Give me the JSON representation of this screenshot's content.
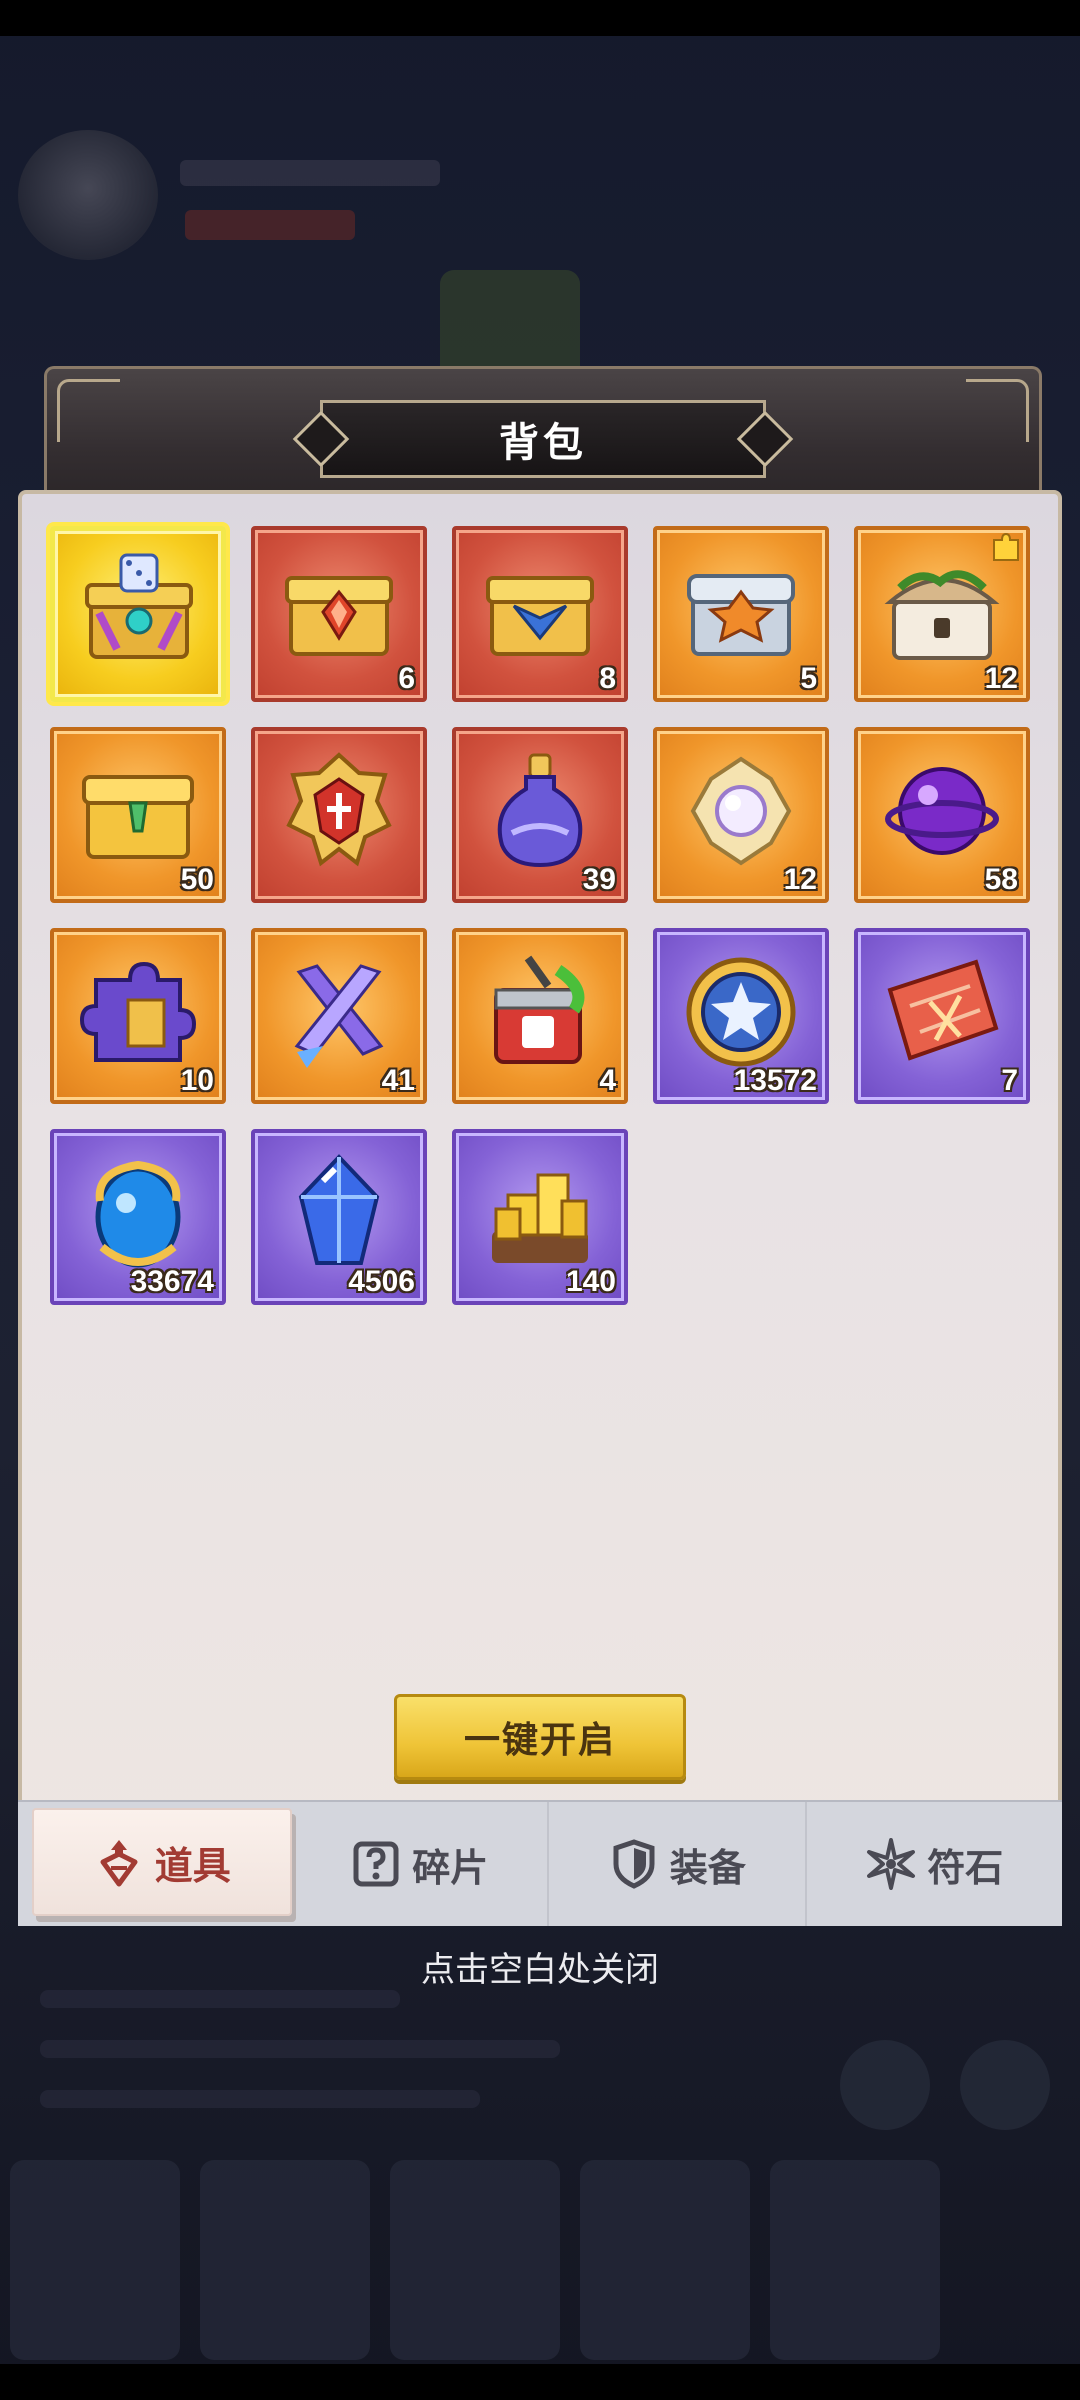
{
  "title": "背包",
  "open_all_label": "一键开启",
  "close_hint": "点击空白处关闭",
  "tabs": [
    {
      "label": "道具",
      "icon": "items-icon",
      "active": true
    },
    {
      "label": "碎片",
      "icon": "fragment-icon",
      "active": false
    },
    {
      "label": "装备",
      "icon": "shield-icon",
      "active": false
    },
    {
      "label": "符石",
      "icon": "rune-icon",
      "active": false
    }
  ],
  "items": [
    {
      "name": "dice-chest",
      "count": "",
      "rarity": "gold"
    },
    {
      "name": "red-gem-chest",
      "count": "6",
      "rarity": "red"
    },
    {
      "name": "blue-gem-chest",
      "count": "8",
      "rarity": "red"
    },
    {
      "name": "silver-gem-chest",
      "count": "5",
      "rarity": "orange"
    },
    {
      "name": "overgrown-chest",
      "count": "12",
      "rarity": "orange"
    },
    {
      "name": "golden-chest",
      "count": "50",
      "rarity": "orange"
    },
    {
      "name": "red-badge",
      "count": "",
      "rarity": "red"
    },
    {
      "name": "purple-potion",
      "count": "39",
      "rarity": "red"
    },
    {
      "name": "pearl-flower",
      "count": "12",
      "rarity": "orange"
    },
    {
      "name": "purple-orb",
      "count": "58",
      "rarity": "orange"
    },
    {
      "name": "puzzle-piece",
      "count": "10",
      "rarity": "orange"
    },
    {
      "name": "crossed-crystals",
      "count": "41",
      "rarity": "orange"
    },
    {
      "name": "food-can",
      "count": "4",
      "rarity": "orange"
    },
    {
      "name": "star-coin",
      "count": "13572",
      "rarity": "purple"
    },
    {
      "name": "red-ticket",
      "count": "7",
      "rarity": "purple"
    },
    {
      "name": "blue-egg-orb",
      "count": "33674",
      "rarity": "purple"
    },
    {
      "name": "blue-crystal",
      "count": "4506",
      "rarity": "purple"
    },
    {
      "name": "gold-bars",
      "count": "140",
      "rarity": "purple"
    }
  ],
  "colors": {
    "gold": "#f7cd1f",
    "orange": "#f0962a",
    "red": "#d1523e",
    "purple": "#8462d6",
    "button": "#efc437",
    "active_tab_text": "#a23b33"
  }
}
